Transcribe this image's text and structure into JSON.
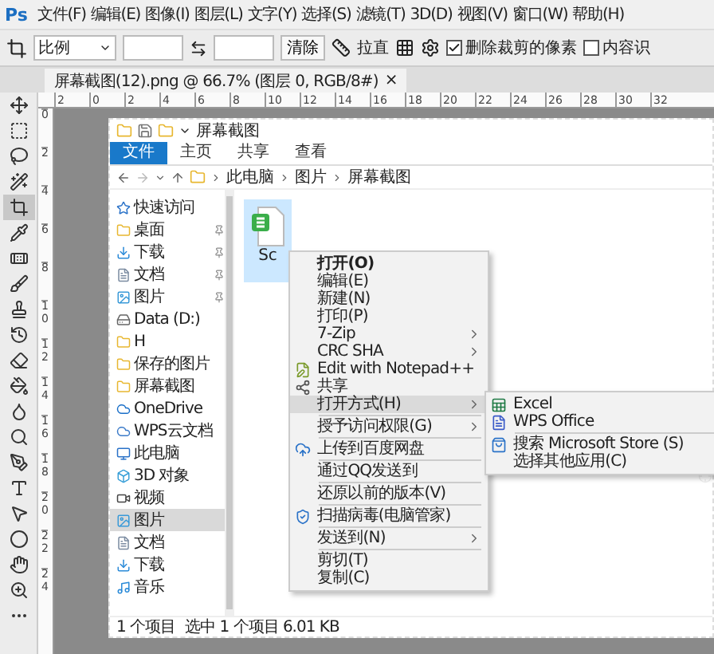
{
  "app": {
    "logo": "Ps",
    "menu": [
      "文件(F)",
      "编辑(E)",
      "图像(I)",
      "图层(L)",
      "文字(Y)",
      "选择(S)",
      "滤镜(T)",
      "3D(D)",
      "视图(V)",
      "窗口(W)",
      "帮助(H)"
    ]
  },
  "options": {
    "preset": "比例",
    "clear": "清除",
    "straighten": "拉直",
    "checkboxes": [
      {
        "label": "删除裁剪的像素",
        "checked": true
      },
      {
        "label": "内容识",
        "checked": false
      }
    ]
  },
  "document_tab": {
    "title": "屏幕截图(12).png @ 66.7% (图层 0, RGB/8#)",
    "close": "×"
  },
  "ruler_h": [
    "2",
    "0",
    "2",
    "4",
    "6",
    "8",
    "10",
    "12",
    "14",
    "16",
    "18",
    "20",
    "22",
    "24",
    "26",
    "28",
    "30",
    "32"
  ],
  "ruler_v": [
    "0",
    "2",
    "4",
    "6",
    "8",
    "10",
    "12",
    "14",
    "16",
    "18",
    "20",
    "22",
    "24"
  ],
  "tools": [
    {
      "kind": "move",
      "selected": false
    },
    {
      "kind": "marquee",
      "selected": false
    },
    {
      "kind": "lasso",
      "selected": false
    },
    {
      "kind": "wand",
      "selected": false
    },
    {
      "kind": "crop",
      "selected": true
    },
    {
      "kind": "eyedropper",
      "selected": false
    },
    {
      "kind": "heal",
      "selected": false
    },
    {
      "kind": "brush",
      "selected": false
    },
    {
      "kind": "stamp",
      "selected": false
    },
    {
      "kind": "history",
      "selected": false
    },
    {
      "kind": "eraser",
      "selected": false
    },
    {
      "kind": "bucket",
      "selected": false
    },
    {
      "kind": "blur",
      "selected": false
    },
    {
      "kind": "dodge",
      "selected": false
    },
    {
      "kind": "pen",
      "selected": false
    },
    {
      "kind": "type",
      "selected": false
    },
    {
      "kind": "select",
      "selected": false
    },
    {
      "kind": "ellipse",
      "selected": false
    },
    {
      "kind": "hand",
      "selected": false
    },
    {
      "kind": "zoom",
      "selected": false
    },
    {
      "kind": "more",
      "selected": false
    }
  ],
  "explorer": {
    "title": "屏幕截图",
    "ribbon_tabs": [
      {
        "label": "文件",
        "selected": true
      },
      {
        "label": "主页",
        "selected": false
      },
      {
        "label": "共享",
        "selected": false
      },
      {
        "label": "查看",
        "selected": false
      }
    ],
    "path": [
      "此电脑",
      "图片",
      "屏幕截图"
    ],
    "nav": [
      {
        "label": "快速访问",
        "kind": "star",
        "pinned": false,
        "selected": false
      },
      {
        "label": "桌面",
        "kind": "folder",
        "pinned": true,
        "selected": false
      },
      {
        "label": "下载",
        "kind": "download",
        "pinned": true,
        "selected": false
      },
      {
        "label": "文档",
        "kind": "document",
        "pinned": true,
        "selected": false
      },
      {
        "label": "图片",
        "kind": "image",
        "pinned": true,
        "selected": false
      },
      {
        "label": "Data (D:)",
        "kind": "drive",
        "pinned": false,
        "selected": false
      },
      {
        "label": "H",
        "kind": "folder",
        "pinned": false,
        "selected": false
      },
      {
        "label": "保存的图片",
        "kind": "folder",
        "pinned": false,
        "selected": false
      },
      {
        "label": "屏幕截图",
        "kind": "folder",
        "pinned": false,
        "selected": false
      },
      {
        "label": "OneDrive",
        "kind": "cloud",
        "pinned": false,
        "selected": false
      },
      {
        "label": "WPS云文档",
        "kind": "cloud-outline",
        "pinned": false,
        "selected": false
      },
      {
        "label": "此电脑",
        "kind": "pc",
        "pinned": false,
        "selected": false
      },
      {
        "label": "3D 对象",
        "kind": "cube",
        "pinned": false,
        "selected": false
      },
      {
        "label": "视频",
        "kind": "video",
        "pinned": false,
        "selected": false
      },
      {
        "label": "图片",
        "kind": "image",
        "pinned": false,
        "selected": true
      },
      {
        "label": "文档",
        "kind": "document",
        "pinned": false,
        "selected": false
      },
      {
        "label": "下载",
        "kind": "download",
        "pinned": false,
        "selected": false
      },
      {
        "label": "音乐",
        "kind": "music",
        "pinned": false,
        "selected": false
      }
    ],
    "file": {
      "name": "Sc",
      "selected": true
    },
    "status": [
      "1 个项目",
      "选中 1 个项目 6.01 KB"
    ]
  },
  "context_menu": [
    {
      "kind": "item",
      "label": "打开(O)",
      "bold": true,
      "submenu": false,
      "selected": false
    },
    {
      "kind": "item",
      "label": "编辑(E)",
      "submenu": false,
      "selected": false
    },
    {
      "kind": "item",
      "label": "新建(N)",
      "submenu": false,
      "selected": false
    },
    {
      "kind": "item",
      "label": "打印(P)",
      "submenu": false,
      "selected": false
    },
    {
      "kind": "item",
      "label": "7-Zip",
      "submenu": true,
      "selected": false
    },
    {
      "kind": "item",
      "label": "CRC SHA",
      "submenu": true,
      "selected": false
    },
    {
      "kind": "notepad",
      "label": "Edit with Notepad++",
      "submenu": false,
      "selected": false
    },
    {
      "kind": "share",
      "label": "共享",
      "submenu": false,
      "selected": false
    },
    {
      "kind": "item",
      "label": "打开方式(H)",
      "submenu": true,
      "selected": true
    },
    {
      "kind": "separator"
    },
    {
      "kind": "item",
      "label": "授予访问权限(G)",
      "submenu": true,
      "selected": false
    },
    {
      "kind": "separator"
    },
    {
      "kind": "upload",
      "label": "上传到百度网盘",
      "submenu": false,
      "selected": false
    },
    {
      "kind": "separator"
    },
    {
      "kind": "item",
      "label": "通过QQ发送到",
      "submenu": false,
      "selected": false
    },
    {
      "kind": "separator"
    },
    {
      "kind": "item",
      "label": "还原以前的版本(V)",
      "submenu": false,
      "selected": false
    },
    {
      "kind": "separator"
    },
    {
      "kind": "shield",
      "label": "扫描病毒(电脑管家)",
      "submenu": false,
      "selected": false
    },
    {
      "kind": "separator"
    },
    {
      "kind": "item",
      "label": "发送到(N)",
      "submenu": true,
      "selected": false
    },
    {
      "kind": "separator"
    },
    {
      "kind": "item",
      "label": "剪切(T)",
      "submenu": false,
      "selected": false
    },
    {
      "kind": "item",
      "label": "复制(C)",
      "submenu": false,
      "selected": false
    }
  ],
  "open_with": [
    {
      "kind": "excel",
      "label": "Excel"
    },
    {
      "kind": "wps",
      "label": "WPS Office"
    },
    {
      "kind": "separator"
    },
    {
      "kind": "store",
      "label": "搜索 Microsoft Store (S)"
    },
    {
      "kind": "item",
      "label": "选择其他应用(C)"
    }
  ]
}
